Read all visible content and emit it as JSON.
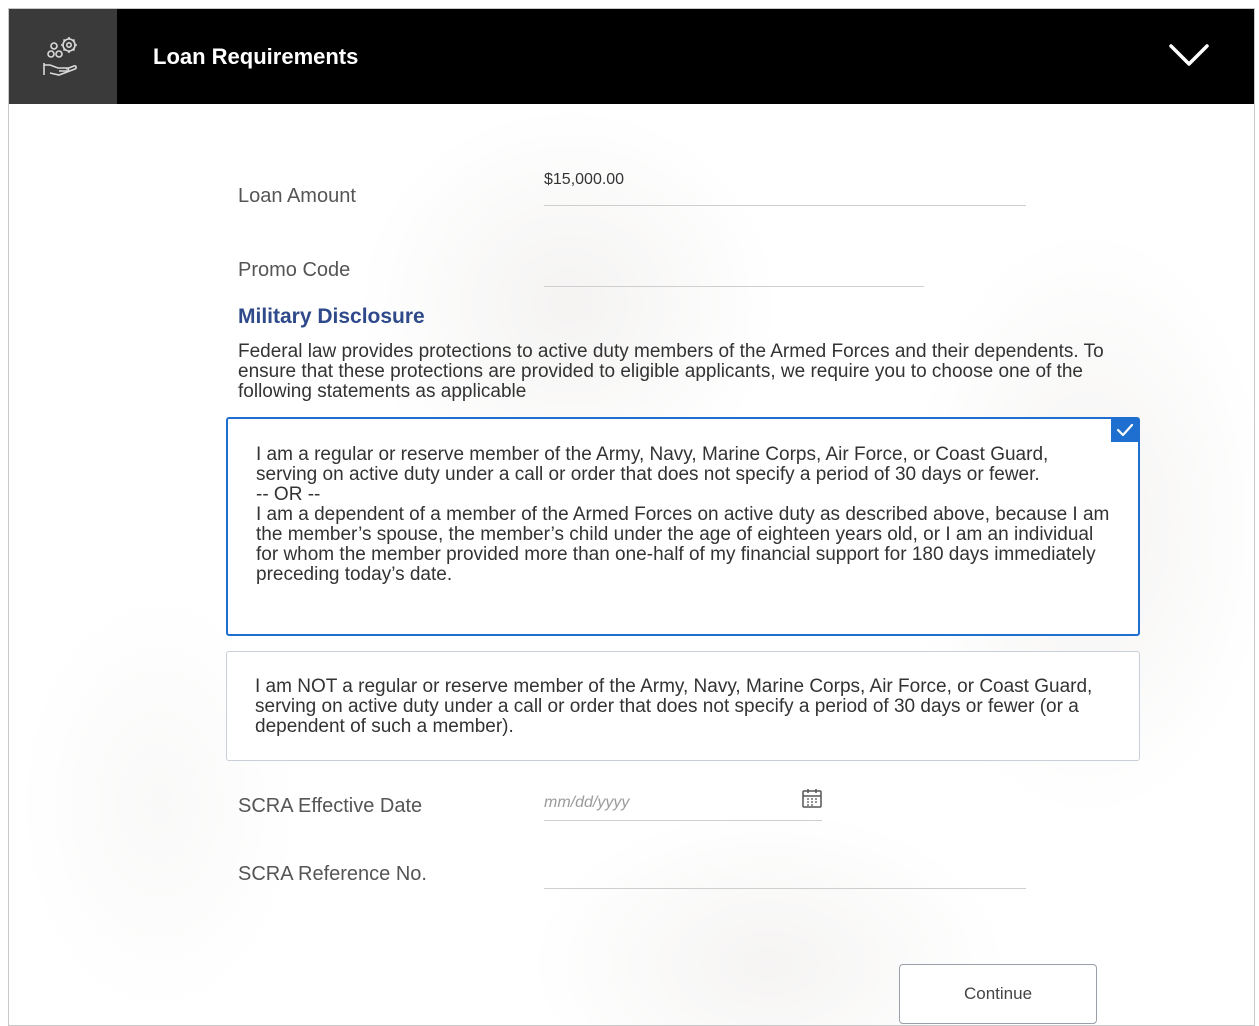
{
  "header": {
    "title": "Loan Requirements",
    "icon": "hand-coins-gear-icon",
    "toggle_icon": "chevron-down-icon"
  },
  "form": {
    "loan_amount": {
      "label": "Loan Amount",
      "value": "$15,000.00"
    },
    "promo_code": {
      "label": "Promo Code",
      "value": ""
    },
    "scra_effective_date": {
      "label": "SCRA Effective Date",
      "placeholder": "mm/dd/yyyy",
      "value": ""
    },
    "scra_reference_no": {
      "label": "SCRA Reference No.",
      "value": ""
    }
  },
  "military_disclosure": {
    "title": "Military Disclosure",
    "description": "Federal law provides protections to active duty members of the Armed Forces and their dependents. To ensure that these protections are provided to eligible applicants, we require you to choose one of the following statements as applicable",
    "options": [
      {
        "text": "I am a regular or reserve member of the Army, Navy, Marine Corps, Air Force, or Coast Guard, serving on active duty under a call or order that does not specify a period of 30 days or fewer.\n-- OR --\nI am a dependent of a member of the Armed Forces on active duty as described above, because I am the member’s spouse, the member’s child under the age of eighteen years old, or I am an individual for whom the member provided more than one-half of my financial support for 180 days immediately preceding today’s date.",
        "selected": true
      },
      {
        "text": "I am NOT a regular or reserve member of the Army, Navy, Marine Corps, Air Force, or Coast Guard, serving on active duty under a call or order that does not specify a period of 30 days or fewer (or a dependent of such a member).",
        "selected": false
      }
    ]
  },
  "actions": {
    "continue_label": "Continue"
  },
  "colors": {
    "header_bg": "#000000",
    "icon_box_bg": "#3a3a3a",
    "accent_blue": "#1f6fd0",
    "section_title": "#2e4a8a"
  }
}
